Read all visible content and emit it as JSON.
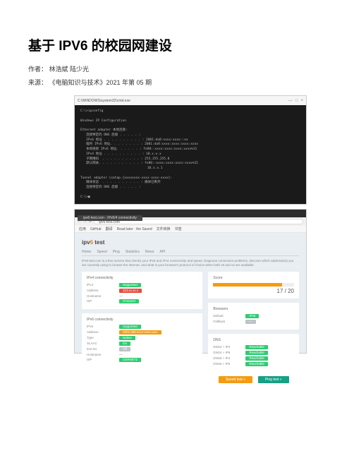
{
  "article": {
    "title": "基于 IPV6 的校园网建设",
    "author_label": "作者：",
    "author_value": "林浩斌 陆少光",
    "source_label": "来源：",
    "source_value": "《电脑知识与技术》2021 年第 05 期"
  },
  "terminal": {
    "title_prefix": "C:\\WINDOWS\\system32\\cmd.exe",
    "min": "—",
    "max": "□",
    "close": "×",
    "lines": [
      "C:\\>ipconfig",
      "",
      "Windows IP Configuration",
      "",
      "Ethernet adapter 本地连接:",
      "   连接特定的 DNS 后缀 . . . . . :",
      "   IPv6 地址 . . . . . . . . . . : 2001:da8:xxxx:xxxx::xx",
      "   临时 IPv6 地址. . . . . . . . : 2001:da8:xxxx:xxxx:xxxx:xxxx",
      "   本地链接 IPv6 地址. . . . . . : fe80::xxxx:xxxx:xxxx:xxxx%11",
      "   IPv4 地址 . . . . . . . . . . : 10.x.x.x",
      "   子网掩码  . . . . . . . . . . : 255.255.255.0",
      "   默认网关. . . . . . . . . . . : fe80::xxxx:xxxx:xxxx:xxxx%11",
      "                                   10.x.x.1",
      "",
      "Tunnel adapter isatap.{xxxxxxxx-xxxx-xxxx-xxxx}:",
      "   媒体状态  . . . . . . . . . . : 媒体已断开",
      "   连接特定的 DNS 后缀 . . . . . :",
      "",
      "C:\\>■"
    ]
  },
  "browser": {
    "tab_label": "ipv6-test.com - IPv6/4 connectivity",
    "nav_back": "←",
    "nav_fwd": "→",
    "nav_reload": "⟳",
    "url": "ipv6-test.com",
    "bookmarks": [
      "应用",
      "GitHub",
      "翻译",
      "Read later · the Saved",
      "文件转换",
      "书签"
    ],
    "logo_ip": "ipv",
    "logo_6": "6",
    "logo_test": " test",
    "nav_tabs": [
      "Home",
      "Speed",
      "Ping",
      "Statistics",
      "News",
      "API"
    ],
    "intro": "IPv6-test.com is a free service that checks your IPv6 and IPv4 connectivity and speed. Diagnose connection problems, discover which address(es) you are currently using to browse the Internet, and what is your browser's protocol of choice when both v6 and v4 are available."
  },
  "ipv4_panel": {
    "title": "IPv4 connectivity",
    "rows": [
      {
        "label": "IPv4",
        "badge": "Supported",
        "cls": "b-green"
      },
      {
        "label": "Address",
        "value": "113.xx.xx.x",
        "cls": "b-red"
      },
      {
        "label": "Hostname",
        "value": "—"
      },
      {
        "label": "ISP",
        "badge": "Chinanet",
        "cls": "b-green"
      }
    ]
  },
  "ipv6_panel": {
    "title": "IPv6 connectivity",
    "rows": [
      {
        "label": "IPv6",
        "badge": "Supported",
        "cls": "b-green"
      },
      {
        "label": "Address",
        "value": "2001:da8:xxxx:xxxx:xxxx",
        "cls": "b-orange"
      },
      {
        "label": "Type",
        "badge": "Native",
        "cls": "b-green"
      },
      {
        "label": "SLAAC",
        "badge": "On",
        "cls": "b-green"
      },
      {
        "label": "EUI-64",
        "badge": "Off",
        "cls": "b-grey"
      },
      {
        "label": "Hostname",
        "value": "—"
      },
      {
        "label": "ISP",
        "badge": "CERNET2",
        "cls": "b-green"
      }
    ]
  },
  "score": {
    "title": "Score",
    "fill_pct": 85,
    "value": "17 / 20"
  },
  "browsers_panel": {
    "title": "Browsers",
    "rows": [
      {
        "label": "Default",
        "badge": "IPv6",
        "cls": "b-green"
      },
      {
        "label": "Fallback",
        "badge": "—",
        "cls": "b-grey"
      }
    ]
  },
  "dns_panel": {
    "title": "DNS",
    "rows": [
      {
        "label": "DNS4 + IP4",
        "badge": "Reachable",
        "cls": "b-green"
      },
      {
        "label": "DNS4 + IP6",
        "badge": "Reachable",
        "cls": "b-green"
      },
      {
        "label": "DNS6 + IP4",
        "badge": "Reachable",
        "cls": "b-green"
      },
      {
        "label": "DNS6 + IP6",
        "badge": "Reachable",
        "cls": "b-green"
      }
    ]
  },
  "buttons": {
    "speed": "Speed test »",
    "ping": "Ping test »"
  }
}
